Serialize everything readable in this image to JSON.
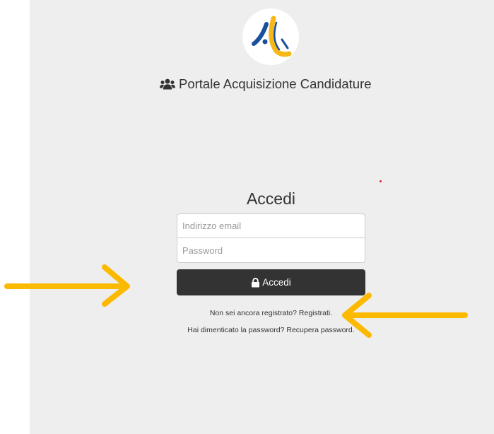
{
  "header": {
    "logo_icon": "portal-logo",
    "portal_icon": "users-icon",
    "portal_title": "Portale Acquisizione Candidature"
  },
  "login": {
    "heading": "Accedi",
    "email_placeholder": "Indirizzo email",
    "password_placeholder": "Password",
    "submit_icon": "lock-icon",
    "submit_label": "Accedi",
    "register_prompt": "Non sei ancora registrato?",
    "register_link": "Registrati.",
    "recover_prompt": "Hai dimenticato la password?",
    "recover_link": "Recupera password."
  },
  "annotations": {
    "arrow_color": "#fbb900",
    "arrows": [
      "arrow-right-icon",
      "arrow-left-icon"
    ]
  },
  "colors": {
    "panel_bg": "#eeeeee",
    "button_bg": "#333333",
    "logo_blue": "#1a4fa0",
    "logo_yellow": "#f6b817"
  }
}
